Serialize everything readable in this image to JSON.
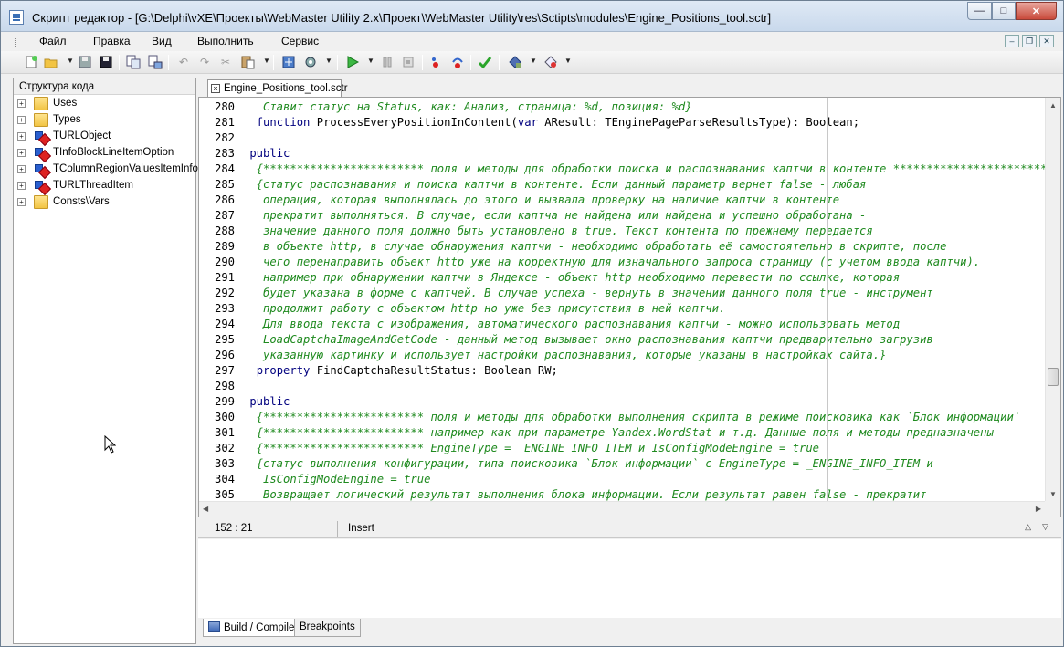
{
  "window": {
    "title": "Скрипт редактор - [G:\\Delphi\\vXE\\Проекты\\WebMaster Utility 2.x\\Проект\\WebMaster Utility\\res\\Sctipts\\modules\\Engine_Positions_tool.sctr]",
    "controls": {
      "minimize": "—",
      "maximize": "□",
      "close": "✕"
    }
  },
  "menu": {
    "items": [
      "Файл",
      "Правка",
      "Вид",
      "Выполнить",
      "Сервис"
    ],
    "mdi": {
      "minimize": "–",
      "restore": "❐",
      "close": "✕"
    }
  },
  "toolbar": {
    "icons": [
      "new-icon",
      "open-icon",
      "save-icon",
      "save-all-icon",
      "copy-file-icon",
      "paste-file-icon",
      "undo-icon",
      "redo-icon",
      "cut-icon",
      "paste-icon",
      "build-icon",
      "settings-icon",
      "run-icon",
      "pause-icon",
      "stop-icon",
      "trace-into-icon",
      "step-over-icon",
      "check-icon",
      "deploy-icon",
      "debug-icon"
    ]
  },
  "code_structure": {
    "title": "Структура кода",
    "items": [
      {
        "label": "Uses",
        "icon": "folder-icon"
      },
      {
        "label": "Types",
        "icon": "folder-icon"
      },
      {
        "label": "TURLObject",
        "icon": "class-icon"
      },
      {
        "label": "TInfoBlockLineItemOption",
        "icon": "class-icon"
      },
      {
        "label": "TColumnRegionValuesItemInfo",
        "icon": "class-icon"
      },
      {
        "label": "TURLThreadItem",
        "icon": "class-icon"
      },
      {
        "label": "Consts\\Vars",
        "icon": "folder-icon"
      }
    ]
  },
  "editor": {
    "tab_label": "Engine_Positions_tool.sctr",
    "tab_close": "×",
    "lines": [
      {
        "num": "280",
        "segments": [
          {
            "t": "   Ставит статус на Status, как: Анализ, страница: %d, позиция: %d}",
            "c": "comment"
          }
        ]
      },
      {
        "num": "281",
        "segments": [
          {
            "t": "  ",
            "c": "plain"
          },
          {
            "t": "function",
            "c": "kw"
          },
          {
            "t": " ProcessEveryPositionInContent(",
            "c": "plain"
          },
          {
            "t": "var",
            "c": "kw"
          },
          {
            "t": " AResult: TEnginePageParseResultsType): Boolean;",
            "c": "plain"
          }
        ]
      },
      {
        "num": "282",
        "segments": [
          {
            "t": "",
            "c": "plain"
          }
        ]
      },
      {
        "num": "283",
        "segments": [
          {
            "t": " ",
            "c": "plain"
          },
          {
            "t": "public",
            "c": "kw"
          }
        ]
      },
      {
        "num": "284",
        "segments": [
          {
            "t": "  {************************ поля и методы для обработки поиска и распознавания каптчи в контенте ************************}",
            "c": "comment"
          }
        ]
      },
      {
        "num": "285",
        "segments": [
          {
            "t": "  {статус распознавания и поиска каптчи в контенте. Если данный параметр вернет false - любая",
            "c": "comment"
          }
        ]
      },
      {
        "num": "286",
        "segments": [
          {
            "t": "   операция, которая выполнялась до этого и вызвала проверку на наличие каптчи в контенте",
            "c": "comment"
          }
        ]
      },
      {
        "num": "287",
        "segments": [
          {
            "t": "   прекратит выполняться. В случае, если каптча не найдена или найдена и успешно обработана -",
            "c": "comment"
          }
        ]
      },
      {
        "num": "288",
        "segments": [
          {
            "t": "   значение данного поля должно быть установлено в true. Текст контента по прежнему передается",
            "c": "comment"
          }
        ]
      },
      {
        "num": "289",
        "segments": [
          {
            "t": "   в объекте http, в случае обнаружения каптчи - необходимо обработать её самостоятельно в скрипте, после",
            "c": "comment"
          }
        ]
      },
      {
        "num": "290",
        "segments": [
          {
            "t": "   чего перенаправить объект http уже на корректную для изначального запроса страницу (с учетом ввода каптчи).",
            "c": "comment"
          }
        ]
      },
      {
        "num": "291",
        "segments": [
          {
            "t": "   например при обнаружении каптчи в Яндексе - объект http необходимо перевести по ссылке, которая",
            "c": "comment"
          }
        ]
      },
      {
        "num": "292",
        "segments": [
          {
            "t": "   будет указана в форме с каптчей. В случае успеха - вернуть в значении данного поля true - инструмент",
            "c": "comment"
          }
        ]
      },
      {
        "num": "293",
        "segments": [
          {
            "t": "   продолжит работу с объектом http но уже без присутствия в ней каптчи.",
            "c": "comment"
          }
        ]
      },
      {
        "num": "294",
        "segments": [
          {
            "t": "   Для ввода текста с изображения, автоматического распознавания каптчи - можно использовать метод",
            "c": "comment"
          }
        ]
      },
      {
        "num": "295",
        "segments": [
          {
            "t": "   LoadCaptchaImageAndGetCode - данный метод вызывает окно распознавания каптчи предварительно загрузив",
            "c": "comment"
          }
        ]
      },
      {
        "num": "296",
        "segments": [
          {
            "t": "   указанную картинку и использует настройки распознавания, которые указаны в настройках сайта.}",
            "c": "comment"
          }
        ]
      },
      {
        "num": "297",
        "segments": [
          {
            "t": "  ",
            "c": "plain"
          },
          {
            "t": "property",
            "c": "kw"
          },
          {
            "t": " FindCaptchaResultStatus: Boolean RW;",
            "c": "plain"
          }
        ]
      },
      {
        "num": "298",
        "segments": [
          {
            "t": "",
            "c": "plain"
          }
        ]
      },
      {
        "num": "299",
        "segments": [
          {
            "t": " ",
            "c": "plain"
          },
          {
            "t": "public",
            "c": "kw"
          }
        ]
      },
      {
        "num": "300",
        "segments": [
          {
            "t": "  {************************ поля и методы для обработки выполнения скрипта в режиме поисковика как `Блок информации`",
            "c": "comment"
          }
        ]
      },
      {
        "num": "301",
        "segments": [
          {
            "t": "  {************************ например как при параметре Yandex.WordStat и т.д. Данные поля и методы предназначены",
            "c": "comment"
          }
        ]
      },
      {
        "num": "302",
        "segments": [
          {
            "t": "  {************************ EngineType = _ENGINE_INFO_ITEM и IsConfigModeEngine = true",
            "c": "comment"
          }
        ]
      },
      {
        "num": "303",
        "segments": [
          {
            "t": "  {статус выполнения конфигурации, типа поисковика `Блок информации` с EngineType = _ENGINE_INFO_ITEM и",
            "c": "comment"
          }
        ]
      },
      {
        "num": "304",
        "segments": [
          {
            "t": "   IsConfigModeEngine = true",
            "c": "comment"
          }
        ]
      },
      {
        "num": "305",
        "segments": [
          {
            "t": "   Возвращает логический результат выполнения блока информации. Если результат равен false - прекратит",
            "c": "comment"
          }
        ]
      }
    ]
  },
  "status": {
    "position": "152 : 21",
    "mode": "Insert"
  },
  "bottom_tabs": [
    "Build / Compile",
    "Breakpoints"
  ]
}
